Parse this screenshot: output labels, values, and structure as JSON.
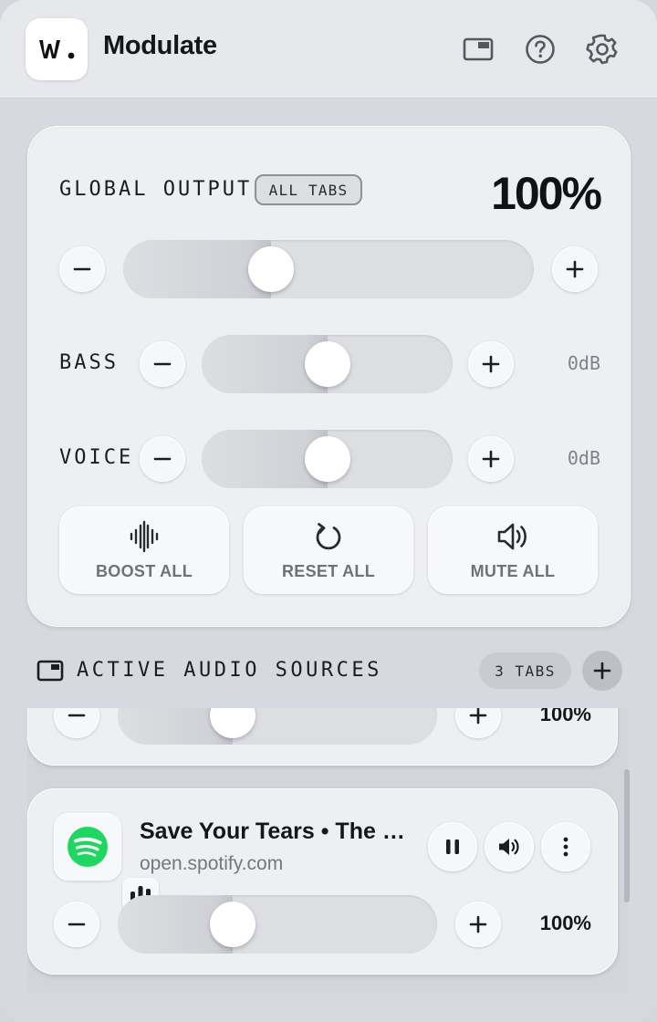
{
  "app": {
    "name": "Modulate",
    "logo_text": "𝗪."
  },
  "header": {
    "icons": [
      "picture-in-picture-icon",
      "help-icon",
      "gear-icon"
    ]
  },
  "global": {
    "label": "GLOBAL OUTPUT",
    "badge": "ALL TABS",
    "value": "100%",
    "slider_level": 0.36,
    "bass": {
      "label": "BASS",
      "value": "0dB",
      "level": 0.5
    },
    "voice": {
      "label": "VOICE",
      "value": "0dB",
      "level": 0.5
    },
    "actions": [
      {
        "label": "BOOST ALL",
        "icon": "waveform-icon"
      },
      {
        "label": "RESET ALL",
        "icon": "reset-icon"
      },
      {
        "label": "MUTE ALL",
        "icon": "speaker-icon"
      }
    ]
  },
  "sources": {
    "title": "ACTIVE AUDIO SOURCES",
    "count": "3 TABS",
    "tabs": [
      {
        "title": "",
        "domain": "",
        "value": "100%",
        "level": 0.36
      },
      {
        "title": "Save Your Tears • The Weeknd",
        "domain": "open.spotify.com",
        "value": "100%",
        "level": 0.36
      }
    ]
  },
  "colors": {
    "background": "#d6d9df",
    "card": "#eeeff2",
    "spotify_green": "#1ed760",
    "muted_text": "#74777d"
  }
}
